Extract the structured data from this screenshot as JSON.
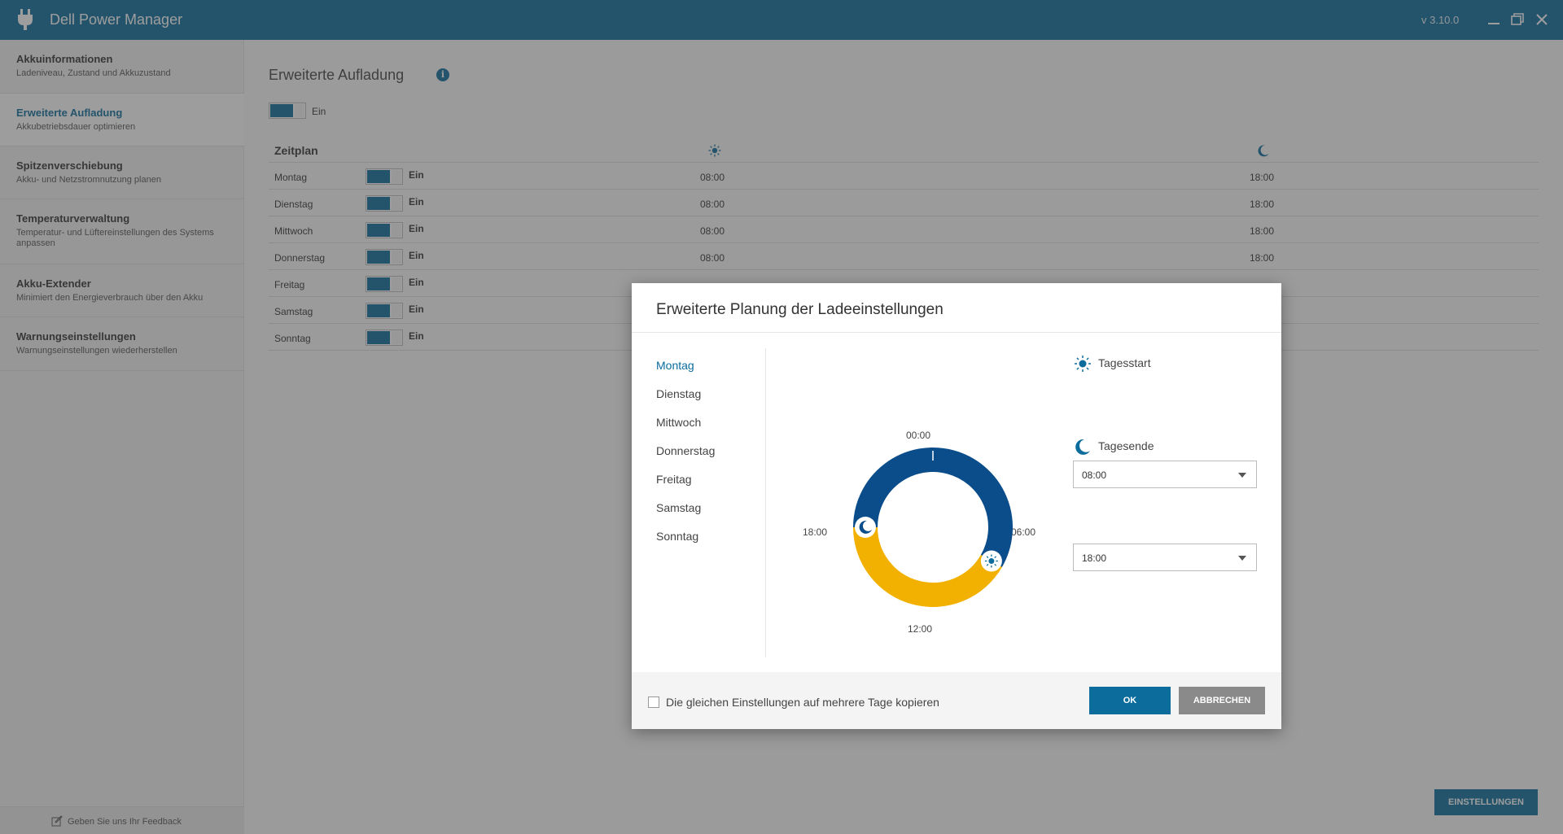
{
  "app": {
    "title": "Dell Power Manager",
    "version": "v 3.10.0"
  },
  "sidebar": {
    "items": [
      {
        "title": "Akkuinformationen",
        "subtitle": "Ladeniveau, Zustand und Akkuzustand"
      },
      {
        "title": "Erweiterte Aufladung",
        "subtitle": "Akkubetriebsdauer optimieren"
      },
      {
        "title": "Spitzenverschiebung",
        "subtitle": "Akku- und Netzstromnutzung planen"
      },
      {
        "title": "Temperaturverwaltung",
        "subtitle": "Temperatur- und Lüftereinstellungen des Systems anpassen"
      },
      {
        "title": "Akku-Extender",
        "subtitle": "Minimiert den Energieverbrauch über den Akku"
      },
      {
        "title": "Warnungseinstellungen",
        "subtitle": "Warnungseinstellungen wiederherstellen"
      }
    ],
    "feedback": "Geben Sie uns Ihr Feedback"
  },
  "main": {
    "title": "Erweiterte Aufladung",
    "toggle_label": "Ein",
    "schedule_header": "Zeitplan",
    "rows": [
      {
        "day": "Montag",
        "state": "Ein",
        "start": "08:00",
        "end": "18:00"
      },
      {
        "day": "Dienstag",
        "state": "Ein",
        "start": "08:00",
        "end": "18:00"
      },
      {
        "day": "Mittwoch",
        "state": "Ein",
        "start": "08:00",
        "end": "18:00"
      },
      {
        "day": "Donnerstag",
        "state": "Ein",
        "start": "08:00",
        "end": "18:00"
      },
      {
        "day": "Freitag",
        "state": "Ein",
        "start": "",
        "end": ""
      },
      {
        "day": "Samstag",
        "state": "Ein",
        "start": "",
        "end": ""
      },
      {
        "day": "Sonntag",
        "state": "Ein",
        "start": "",
        "end": ""
      }
    ],
    "settings_button": "EINSTELLUNGEN"
  },
  "dialog": {
    "title": "Erweiterte Planung der Ladeeinstellungen",
    "days": [
      "Montag",
      "Dienstag",
      "Mittwoch",
      "Donnerstag",
      "Freitag",
      "Samstag",
      "Sonntag"
    ],
    "clock_labels": {
      "top": "00:00",
      "right": "06:00",
      "bottom": "12:00",
      "left": "18:00"
    },
    "day_start": {
      "label": "Tagesstart",
      "value": "08:00",
      "hour": 8
    },
    "day_end": {
      "label": "Tagesende",
      "value": "18:00",
      "hour": 18
    },
    "copy_checkbox": "Die gleichen Einstellungen auf mehrere Tage kopieren",
    "ok": "OK",
    "cancel": "ABBRECHEN"
  },
  "colors": {
    "accent": "#0c6c9c",
    "night_ring": "#0a4d8a",
    "day_ring": "#f2b100"
  }
}
